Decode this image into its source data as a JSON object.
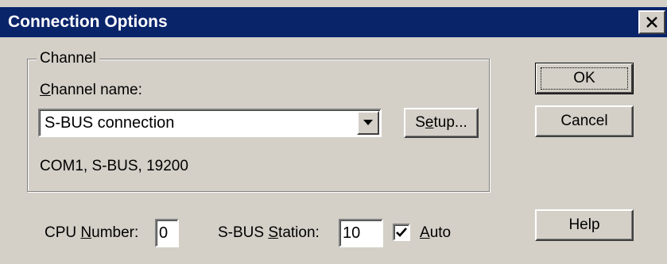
{
  "window": {
    "title": "Connection Options",
    "close_icon": "close-icon"
  },
  "channel": {
    "group_label": "Channel",
    "name_label": "Channel name:",
    "name_selected": "S-BUS connection",
    "setup_label": "Setup...",
    "details": "COM1, S-BUS, 19200"
  },
  "buttons": {
    "ok": "OK",
    "cancel": "Cancel",
    "help": "Help"
  },
  "cpu": {
    "label": "CPU Number:",
    "value": "0"
  },
  "station": {
    "label": "S-BUS Station:",
    "value": "10"
  },
  "auto": {
    "label": "Auto",
    "checked": true
  },
  "colors": {
    "titlebar": "#0a246a",
    "face": "#d4d0c8"
  }
}
